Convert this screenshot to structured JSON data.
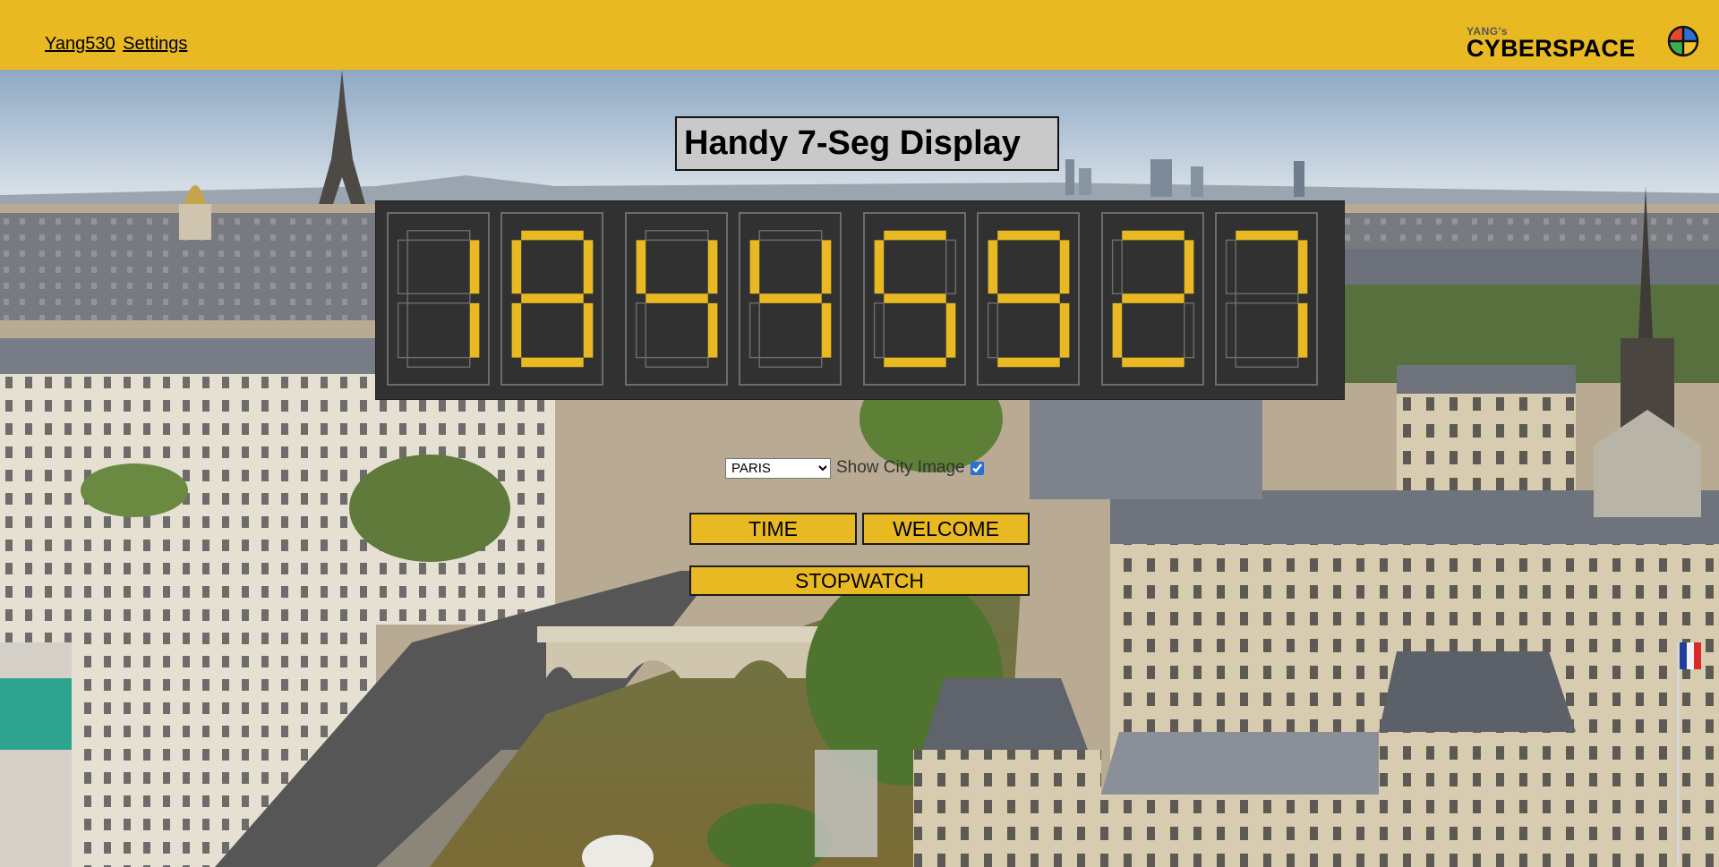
{
  "header": {
    "nav": [
      {
        "label": "Yang530"
      },
      {
        "label": "Settings"
      }
    ],
    "logo": {
      "small": "YANG's",
      "big": "CYBERSPACE",
      "icon": "globe-icon"
    },
    "bg_color": "#e8b923"
  },
  "title": "Handy 7-Seg Display",
  "display": {
    "digits": [
      "1",
      "8",
      "4",
      "4",
      "5",
      "9",
      "2",
      "7"
    ],
    "segment_on_color": "#e8b923",
    "segment_off_color": "#6c6c6c",
    "panel_color": "#313131"
  },
  "controls": {
    "city_select": {
      "value": "PARIS",
      "options": [
        "PARIS"
      ]
    },
    "show_city_image_label": "Show City Image",
    "show_city_image_checked": true
  },
  "buttons": {
    "time": "TIME",
    "welcome": "WELCOME",
    "stopwatch": "STOPWATCH"
  },
  "background": {
    "city": "Paris",
    "accent": "#e8b923"
  }
}
